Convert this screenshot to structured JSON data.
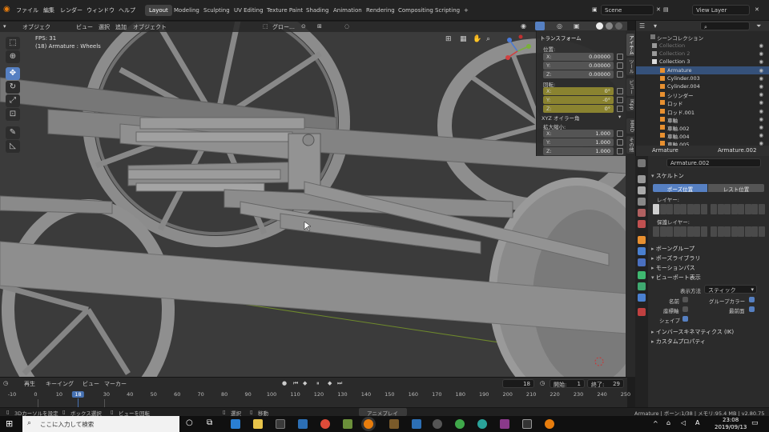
{
  "menu": {
    "items": [
      "ファイル",
      "編集",
      "レンダー",
      "ウィンドウ",
      "ヘルプ"
    ]
  },
  "workspaces": [
    "Layout",
    "Modeling",
    "Sculpting",
    "UV Editing",
    "Texture Paint",
    "Shading",
    "Animation",
    "Rendering",
    "Compositing",
    "Scripting",
    "+"
  ],
  "scene": {
    "name": "Scene",
    "view_layer": "View Layer"
  },
  "viewport": {
    "mode": "オブジェク",
    "menus": [
      "ビュー",
      "選択",
      "追加",
      "オブジェクト"
    ],
    "orientation": "グロー…",
    "fps": "FPS: 31",
    "object_info": "(18) Armature : Wheels"
  },
  "npanel": {
    "title": "トランスフォーム",
    "location_label": "位置:",
    "location": [
      {
        "axis": "X:",
        "value": "0.00000"
      },
      {
        "axis": "Y:",
        "value": "0.00000"
      },
      {
        "axis": "Z:",
        "value": "0.00000"
      }
    ],
    "rotation_label": "回転:",
    "rotation": [
      {
        "axis": "X:",
        "value": "0°"
      },
      {
        "axis": "Y:",
        "value": "-0°"
      },
      {
        "axis": "Z:",
        "value": "0°"
      }
    ],
    "rotation_mode": "XYZ オイラー角",
    "scale_label": "拡大縮小:",
    "scale": [
      {
        "axis": "X:",
        "value": "1.000"
      },
      {
        "axis": "Y:",
        "value": "1.000"
      },
      {
        "axis": "Z:",
        "value": "1.000"
      }
    ],
    "tabs": [
      "アイテム",
      "ツール",
      "ビュー",
      "IKpp",
      "MMD",
      "その他"
    ]
  },
  "outliner": {
    "root": "シーンコレクション",
    "rows": [
      {
        "name": "Collection",
        "indent": 1,
        "dim": true
      },
      {
        "name": "Collection 2",
        "indent": 1,
        "dim": true
      },
      {
        "name": "Collection 3",
        "indent": 1,
        "dim": false
      },
      {
        "name": "Armature",
        "indent": 2,
        "dim": false,
        "selected": true
      },
      {
        "name": "Cylinder.003",
        "indent": 2,
        "dim": false
      },
      {
        "name": "Cylinder.004",
        "indent": 2,
        "dim": false
      },
      {
        "name": "シリンダー",
        "indent": 2,
        "dim": false
      },
      {
        "name": "ロッド",
        "indent": 2,
        "dim": false
      },
      {
        "name": "ロッド.001",
        "indent": 2,
        "dim": false
      },
      {
        "name": "車軸",
        "indent": 2,
        "dim": false
      },
      {
        "name": "車軸.002",
        "indent": 2,
        "dim": false
      },
      {
        "name": "車軸.004",
        "indent": 2,
        "dim": false
      },
      {
        "name": "車軸.005",
        "indent": 2,
        "dim": false
      }
    ]
  },
  "properties": {
    "object": "Armature",
    "data": "Armature.002",
    "data_field": "Armature.002",
    "skeleton": "スケルトン",
    "pose_button": "ポーズ位置",
    "rest_button": "レスト位置",
    "layers": "レイヤー:",
    "protected_layers": "保護レイヤー:",
    "sections": [
      "ボーングループ",
      "ポーズライブラリ",
      "モーションパス",
      "ビューポート表示"
    ],
    "display_as_label": "表示方法",
    "display_as": "スティック",
    "names": "名前",
    "group_colors": "グループカラー",
    "axes": "座標軸",
    "in_front": "最前面",
    "shapes": "シェイプ",
    "ik": "インバースキネマティクス (IK)",
    "custom": "カスタムプロパティ"
  },
  "timeline": {
    "menus": [
      "再生",
      "キーイング",
      "ビュー",
      "マーカー"
    ],
    "current": "18",
    "start_label": "開始:",
    "start": "1",
    "end_label": "終了:",
    "end": "29",
    "ticks": [
      "-10",
      "0",
      "10",
      "18",
      "30",
      "40",
      "50",
      "60",
      "70",
      "80",
      "90",
      "100",
      "110",
      "120",
      "130",
      "140",
      "150",
      "160",
      "170",
      "180",
      "190",
      "200",
      "210",
      "220",
      "230",
      "240",
      "250"
    ],
    "tick_values": [
      -10,
      0,
      10,
      18,
      30,
      40,
      50,
      60,
      70,
      80,
      90,
      100,
      110,
      120,
      130,
      140,
      150,
      160,
      170,
      180,
      190,
      200,
      210,
      220,
      230,
      240,
      250
    ]
  },
  "status": {
    "items": [
      "3Dカーソルを設定",
      "ボックス選択",
      "ビューを回転",
      "選択",
      "移動",
      "アニメプレイ"
    ],
    "info": "Armature | ボーン:1/38 | メモリ:95.4 MB | v2.80.75"
  },
  "taskbar": {
    "search_placeholder": "ここに入力して検索",
    "time": "23:08",
    "date": "2019/09/13"
  },
  "colors": {
    "accent": "#5680c2",
    "selected_row": "#35517a",
    "rotation_field": "#8a8330",
    "playhead": "#4772b3"
  }
}
